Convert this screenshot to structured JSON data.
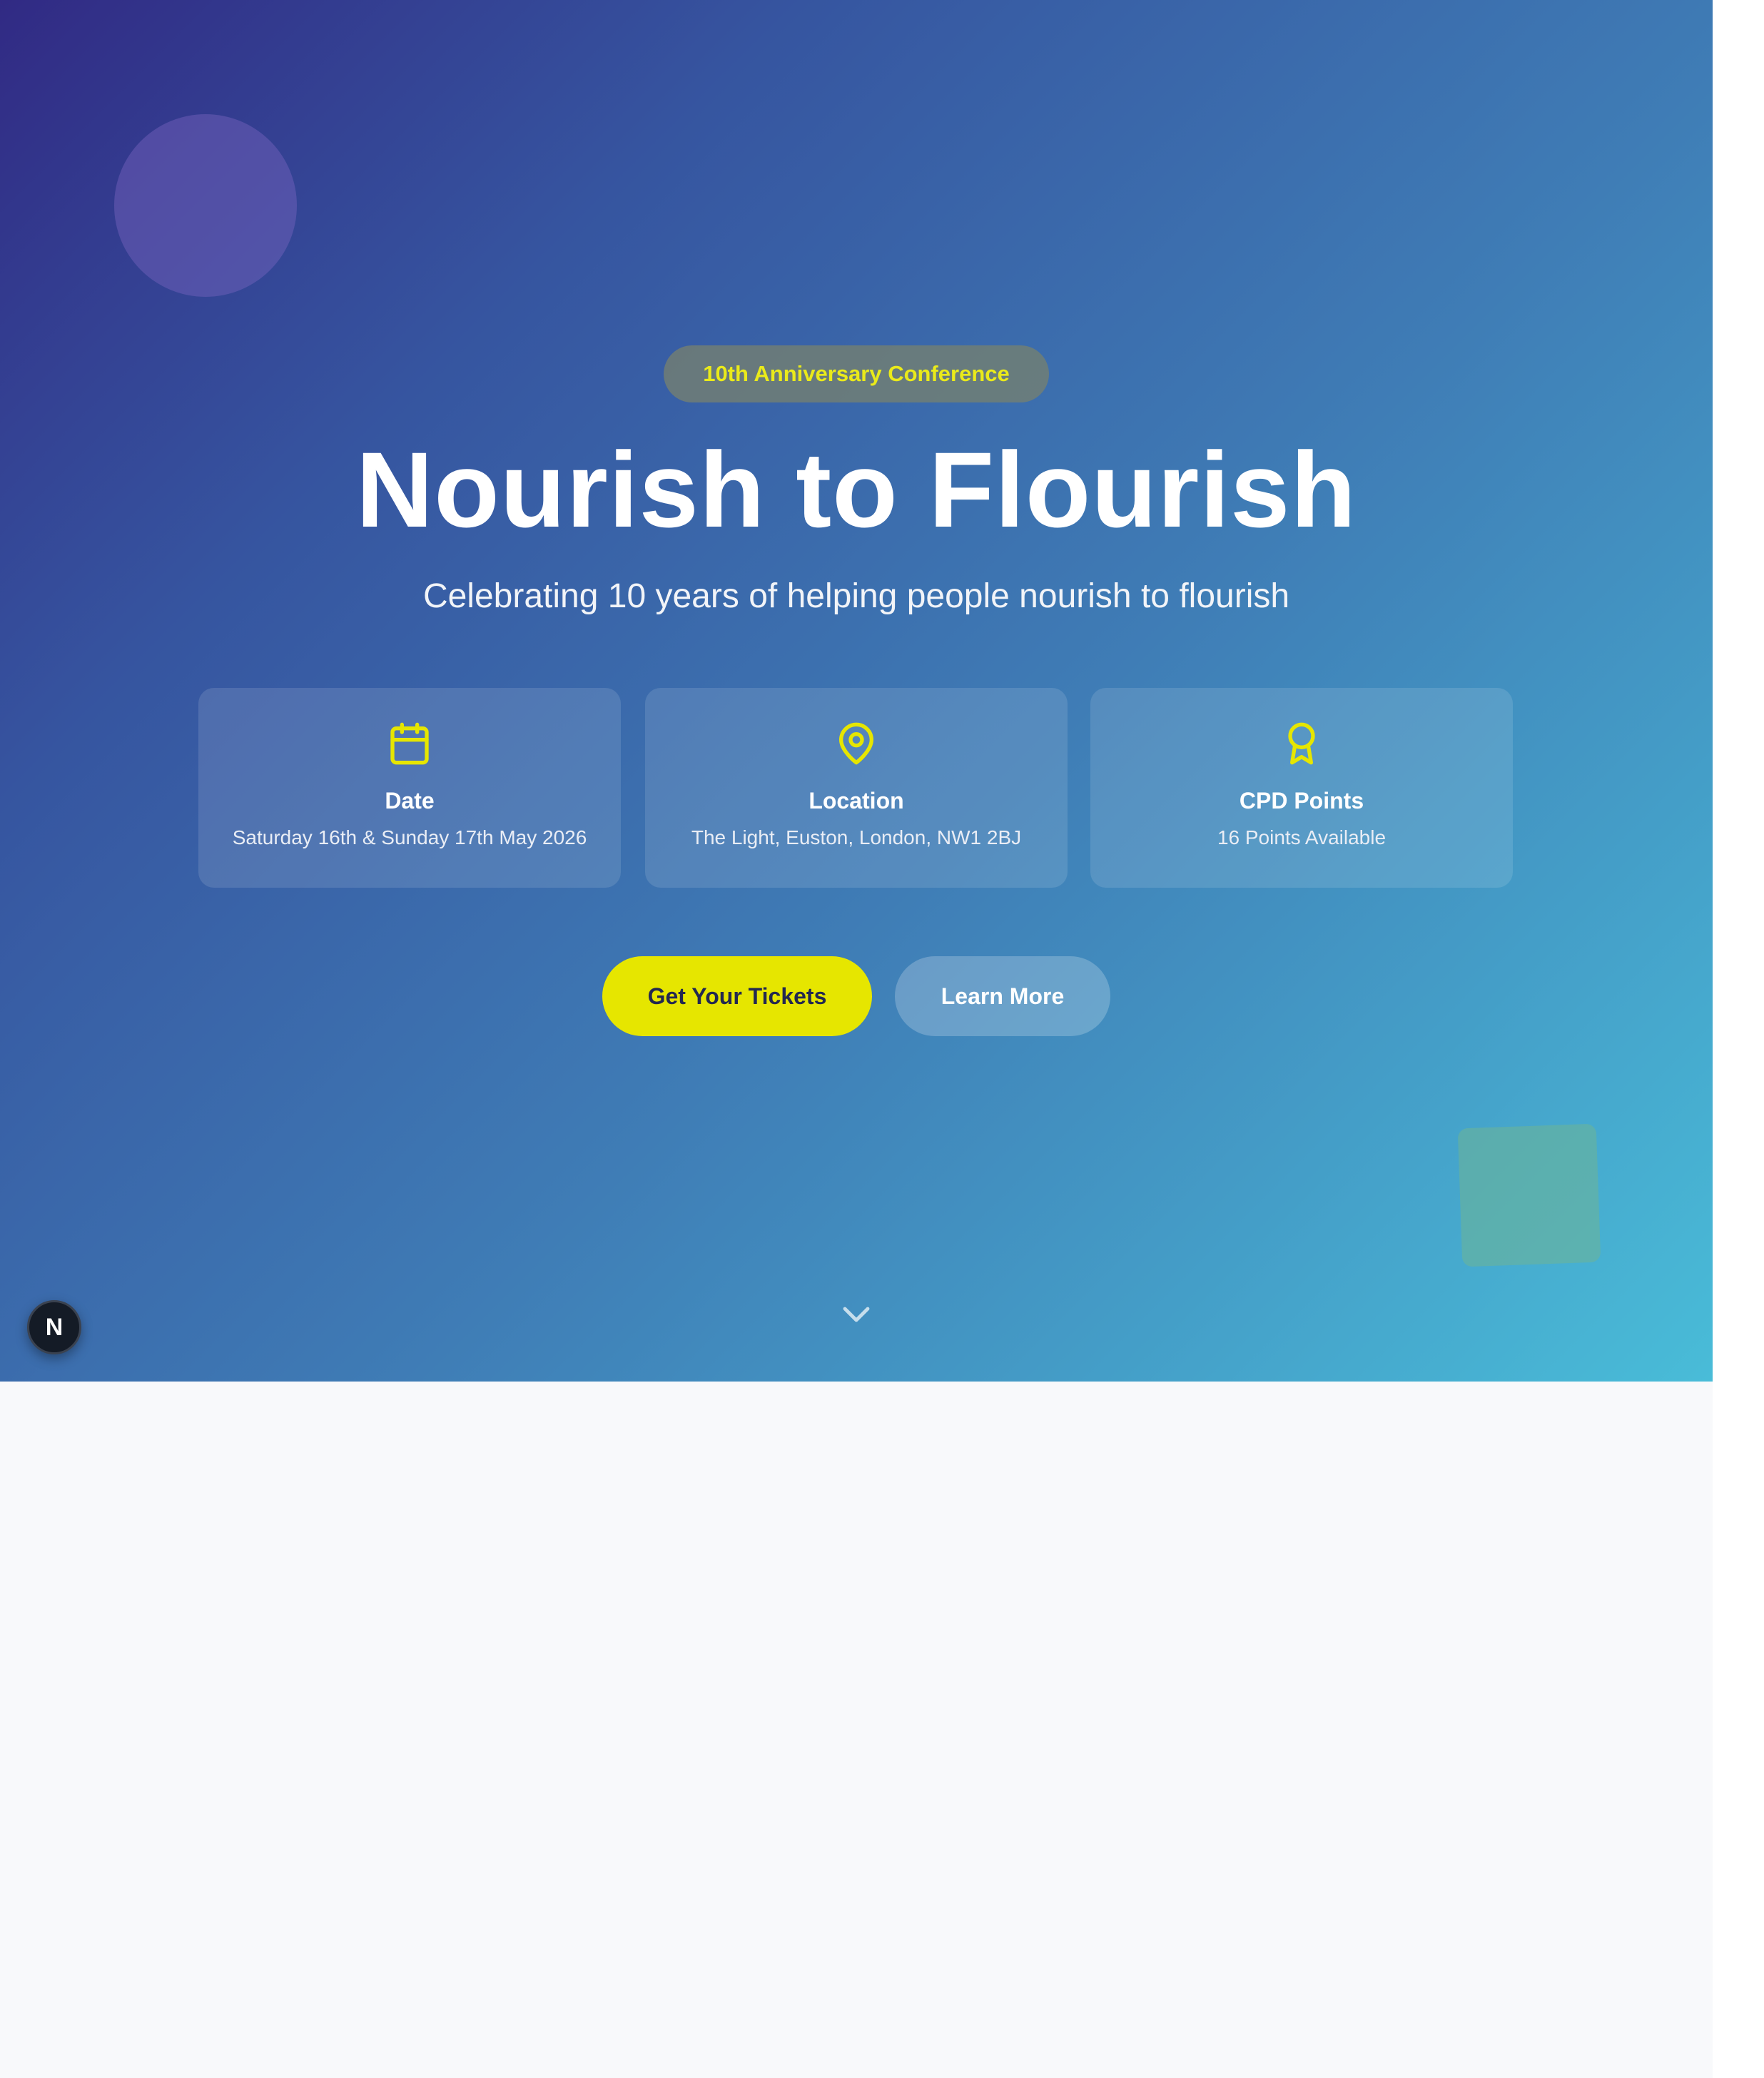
{
  "hero": {
    "badge": "10th Anniversary Conference",
    "title": "Nourish to Flourish",
    "subtitle": "Celebrating 10 years of helping people nourish to flourish"
  },
  "cards": [
    {
      "icon": "calendar-icon",
      "label": "Date",
      "value": "Saturday 16th & Sunday 17th May 2026"
    },
    {
      "icon": "map-pin-icon",
      "label": "Location",
      "value": "The Light, Euston, London, NW1 2BJ"
    },
    {
      "icon": "award-icon",
      "label": "CPD Points",
      "value": "16 Points Available"
    }
  ],
  "actions": {
    "tickets_label": "Get Your Tickets",
    "learn_label": "Learn More"
  },
  "dev_badge": {
    "label": "N",
    "icon": "nextjs-logo-icon"
  },
  "colors": {
    "accent": "#e6e600",
    "gradient_start": "#312a84",
    "gradient_end": "#49bcd8",
    "page_background": "#f8f9fb"
  }
}
